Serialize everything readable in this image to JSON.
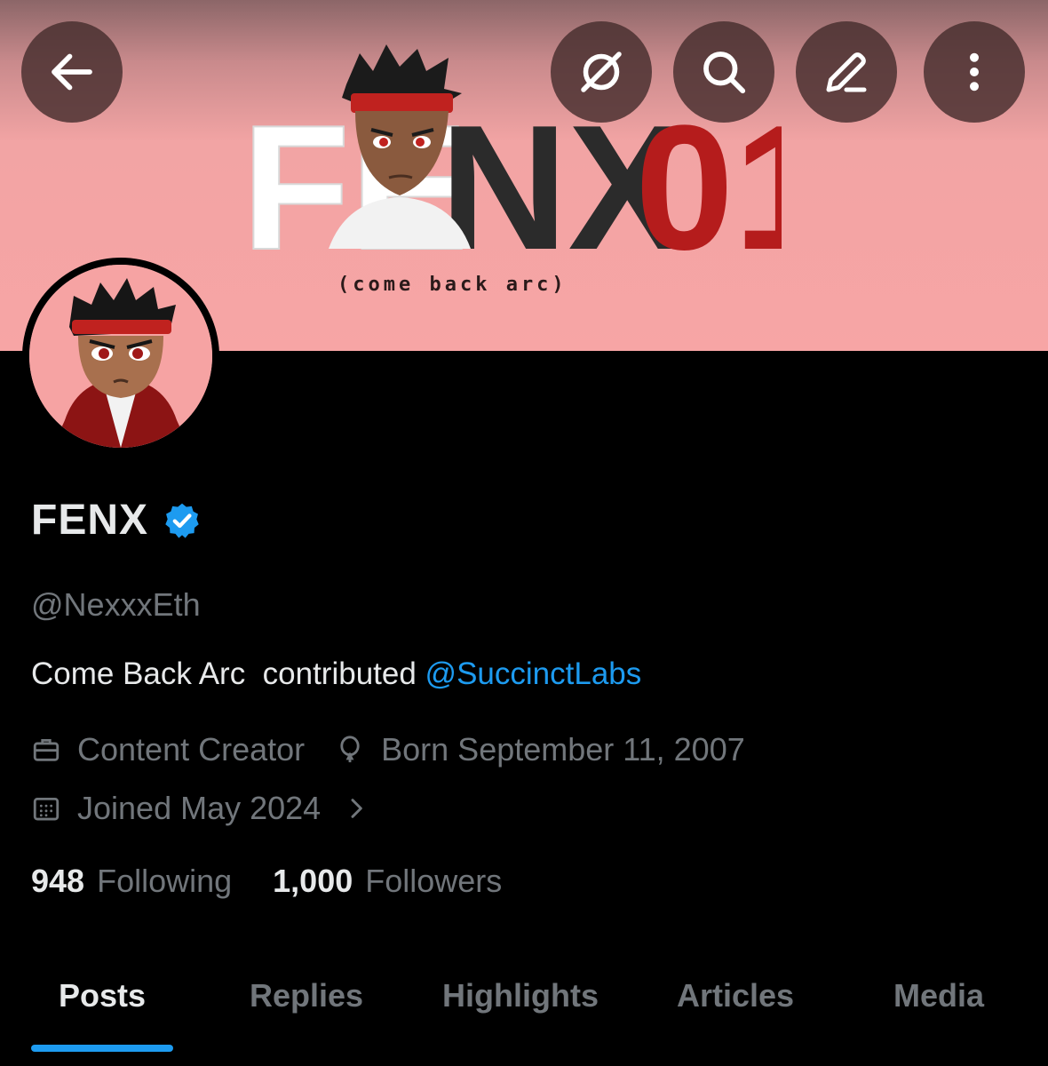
{
  "banner": {
    "title_white": "FE",
    "title_mid": "NX",
    "title_red": "01",
    "subtitle": "(come back arc)"
  },
  "header_buttons": {
    "back": "back-arrow-icon",
    "grok": "grok-icon",
    "search": "search-icon",
    "edit": "edit-icon",
    "more": "more-vertical-icon"
  },
  "profile": {
    "display_name": "FENX",
    "verified": true,
    "handle": "@NexxxEth",
    "bio_text": "Come Back Arc  contributed ",
    "bio_mention": "@SuccinctLabs",
    "category": "Content Creator",
    "birthday": "Born September 11, 2007",
    "joined": "Joined May 2024"
  },
  "stats": {
    "following_count": "948",
    "following_label": "Following",
    "followers_count": "1,000",
    "followers_label": "Followers"
  },
  "tabs": [
    {
      "label": "Posts",
      "active": true
    },
    {
      "label": "Replies",
      "active": false
    },
    {
      "label": "Highlights",
      "active": false
    },
    {
      "label": "Articles",
      "active": false
    },
    {
      "label": "Media",
      "active": false
    }
  ],
  "colors": {
    "accent": "#1d9bf0",
    "banner": "#f7a5a5",
    "brand_red": "#b51c1c",
    "muted_text": "#71767b"
  }
}
